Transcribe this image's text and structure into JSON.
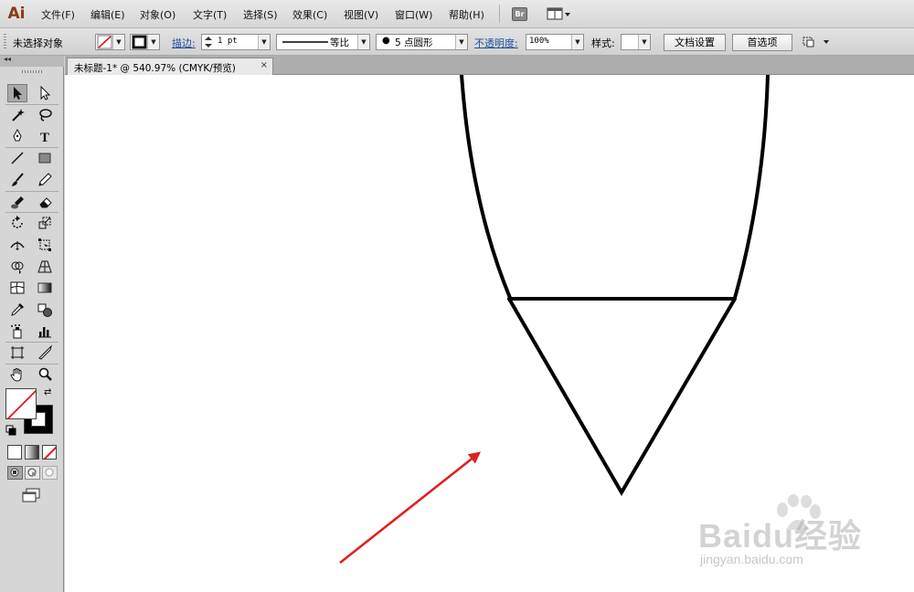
{
  "app": {
    "logo": "Ai",
    "bridge_label": "Br"
  },
  "menu": {
    "items": [
      {
        "label": "文件(F)"
      },
      {
        "label": "编辑(E)"
      },
      {
        "label": "对象(O)"
      },
      {
        "label": "文字(T)"
      },
      {
        "label": "选择(S)"
      },
      {
        "label": "效果(C)"
      },
      {
        "label": "视图(V)"
      },
      {
        "label": "窗口(W)"
      },
      {
        "label": "帮助(H)"
      }
    ]
  },
  "control_bar": {
    "selection_status": "未选择对象",
    "stroke_label": "描边:",
    "stroke_weight": "1 pt",
    "stroke_profile": "等比",
    "brush_definition": "5 点圆形",
    "opacity_label": "不透明度:",
    "opacity_value": "100%",
    "style_label": "样式:",
    "document_setup_button": "文档设置",
    "preferences_button": "首选项"
  },
  "document": {
    "tab_title": "未标题-1* @ 540.97% (CMYK/预览)",
    "close_glyph": "×"
  },
  "canvas": {
    "stroke_color": "#000000",
    "arrow_color": "#e02020"
  },
  "watermark": {
    "brand": "Baidu经验",
    "url": "jingyan.baidu.com"
  },
  "tools": [
    {
      "name": "selection-tool",
      "active": true
    },
    {
      "name": "direct-selection-tool"
    },
    {
      "name": "magic-wand-tool"
    },
    {
      "name": "lasso-tool"
    },
    {
      "name": "pen-tool"
    },
    {
      "name": "type-tool"
    },
    {
      "name": "line-segment-tool"
    },
    {
      "name": "rectangle-tool"
    },
    {
      "name": "paintbrush-tool"
    },
    {
      "name": "pencil-tool"
    },
    {
      "name": "blob-brush-tool"
    },
    {
      "name": "eraser-tool"
    },
    {
      "name": "rotate-tool"
    },
    {
      "name": "scale-tool"
    },
    {
      "name": "width-tool"
    },
    {
      "name": "free-transform-tool"
    },
    {
      "name": "shape-builder-tool"
    },
    {
      "name": "perspective-grid-tool"
    },
    {
      "name": "mesh-tool"
    },
    {
      "name": "gradient-tool"
    },
    {
      "name": "eyedropper-tool"
    },
    {
      "name": "blend-tool"
    },
    {
      "name": "symbol-sprayer-tool"
    },
    {
      "name": "column-graph-tool"
    },
    {
      "name": "artboard-tool"
    },
    {
      "name": "slice-tool"
    },
    {
      "name": "hand-tool"
    },
    {
      "name": "zoom-tool"
    }
  ]
}
